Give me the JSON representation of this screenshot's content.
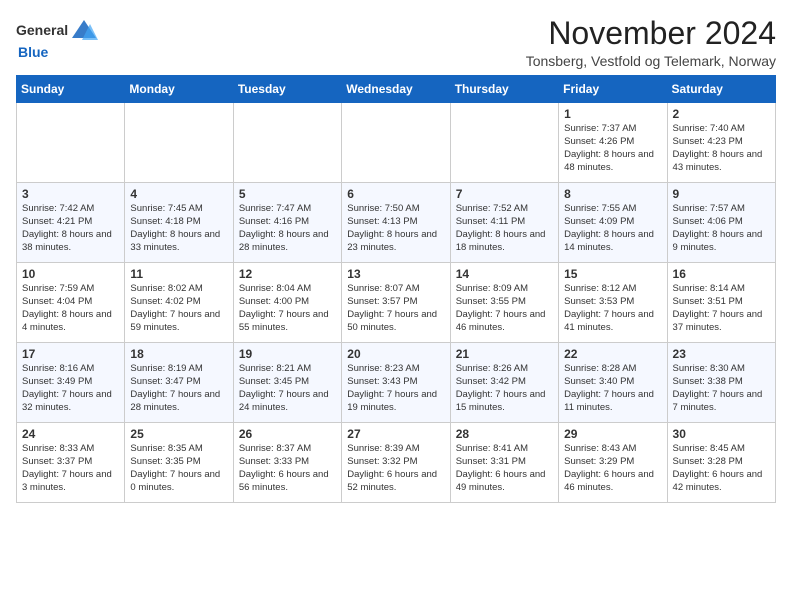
{
  "header": {
    "logo_general": "General",
    "logo_blue": "Blue",
    "month_title": "November 2024",
    "subtitle": "Tonsberg, Vestfold og Telemark, Norway"
  },
  "days_of_week": [
    "Sunday",
    "Monday",
    "Tuesday",
    "Wednesday",
    "Thursday",
    "Friday",
    "Saturday"
  ],
  "weeks": [
    [
      {
        "day": "",
        "info": ""
      },
      {
        "day": "",
        "info": ""
      },
      {
        "day": "",
        "info": ""
      },
      {
        "day": "",
        "info": ""
      },
      {
        "day": "",
        "info": ""
      },
      {
        "day": "1",
        "info": "Sunrise: 7:37 AM\nSunset: 4:26 PM\nDaylight: 8 hours and 48 minutes."
      },
      {
        "day": "2",
        "info": "Sunrise: 7:40 AM\nSunset: 4:23 PM\nDaylight: 8 hours and 43 minutes."
      }
    ],
    [
      {
        "day": "3",
        "info": "Sunrise: 7:42 AM\nSunset: 4:21 PM\nDaylight: 8 hours and 38 minutes."
      },
      {
        "day": "4",
        "info": "Sunrise: 7:45 AM\nSunset: 4:18 PM\nDaylight: 8 hours and 33 minutes."
      },
      {
        "day": "5",
        "info": "Sunrise: 7:47 AM\nSunset: 4:16 PM\nDaylight: 8 hours and 28 minutes."
      },
      {
        "day": "6",
        "info": "Sunrise: 7:50 AM\nSunset: 4:13 PM\nDaylight: 8 hours and 23 minutes."
      },
      {
        "day": "7",
        "info": "Sunrise: 7:52 AM\nSunset: 4:11 PM\nDaylight: 8 hours and 18 minutes."
      },
      {
        "day": "8",
        "info": "Sunrise: 7:55 AM\nSunset: 4:09 PM\nDaylight: 8 hours and 14 minutes."
      },
      {
        "day": "9",
        "info": "Sunrise: 7:57 AM\nSunset: 4:06 PM\nDaylight: 8 hours and 9 minutes."
      }
    ],
    [
      {
        "day": "10",
        "info": "Sunrise: 7:59 AM\nSunset: 4:04 PM\nDaylight: 8 hours and 4 minutes."
      },
      {
        "day": "11",
        "info": "Sunrise: 8:02 AM\nSunset: 4:02 PM\nDaylight: 7 hours and 59 minutes."
      },
      {
        "day": "12",
        "info": "Sunrise: 8:04 AM\nSunset: 4:00 PM\nDaylight: 7 hours and 55 minutes."
      },
      {
        "day": "13",
        "info": "Sunrise: 8:07 AM\nSunset: 3:57 PM\nDaylight: 7 hours and 50 minutes."
      },
      {
        "day": "14",
        "info": "Sunrise: 8:09 AM\nSunset: 3:55 PM\nDaylight: 7 hours and 46 minutes."
      },
      {
        "day": "15",
        "info": "Sunrise: 8:12 AM\nSunset: 3:53 PM\nDaylight: 7 hours and 41 minutes."
      },
      {
        "day": "16",
        "info": "Sunrise: 8:14 AM\nSunset: 3:51 PM\nDaylight: 7 hours and 37 minutes."
      }
    ],
    [
      {
        "day": "17",
        "info": "Sunrise: 8:16 AM\nSunset: 3:49 PM\nDaylight: 7 hours and 32 minutes."
      },
      {
        "day": "18",
        "info": "Sunrise: 8:19 AM\nSunset: 3:47 PM\nDaylight: 7 hours and 28 minutes."
      },
      {
        "day": "19",
        "info": "Sunrise: 8:21 AM\nSunset: 3:45 PM\nDaylight: 7 hours and 24 minutes."
      },
      {
        "day": "20",
        "info": "Sunrise: 8:23 AM\nSunset: 3:43 PM\nDaylight: 7 hours and 19 minutes."
      },
      {
        "day": "21",
        "info": "Sunrise: 8:26 AM\nSunset: 3:42 PM\nDaylight: 7 hours and 15 minutes."
      },
      {
        "day": "22",
        "info": "Sunrise: 8:28 AM\nSunset: 3:40 PM\nDaylight: 7 hours and 11 minutes."
      },
      {
        "day": "23",
        "info": "Sunrise: 8:30 AM\nSunset: 3:38 PM\nDaylight: 7 hours and 7 minutes."
      }
    ],
    [
      {
        "day": "24",
        "info": "Sunrise: 8:33 AM\nSunset: 3:37 PM\nDaylight: 7 hours and 3 minutes."
      },
      {
        "day": "25",
        "info": "Sunrise: 8:35 AM\nSunset: 3:35 PM\nDaylight: 7 hours and 0 minutes."
      },
      {
        "day": "26",
        "info": "Sunrise: 8:37 AM\nSunset: 3:33 PM\nDaylight: 6 hours and 56 minutes."
      },
      {
        "day": "27",
        "info": "Sunrise: 8:39 AM\nSunset: 3:32 PM\nDaylight: 6 hours and 52 minutes."
      },
      {
        "day": "28",
        "info": "Sunrise: 8:41 AM\nSunset: 3:31 PM\nDaylight: 6 hours and 49 minutes."
      },
      {
        "day": "29",
        "info": "Sunrise: 8:43 AM\nSunset: 3:29 PM\nDaylight: 6 hours and 46 minutes."
      },
      {
        "day": "30",
        "info": "Sunrise: 8:45 AM\nSunset: 3:28 PM\nDaylight: 6 hours and 42 minutes."
      }
    ]
  ]
}
